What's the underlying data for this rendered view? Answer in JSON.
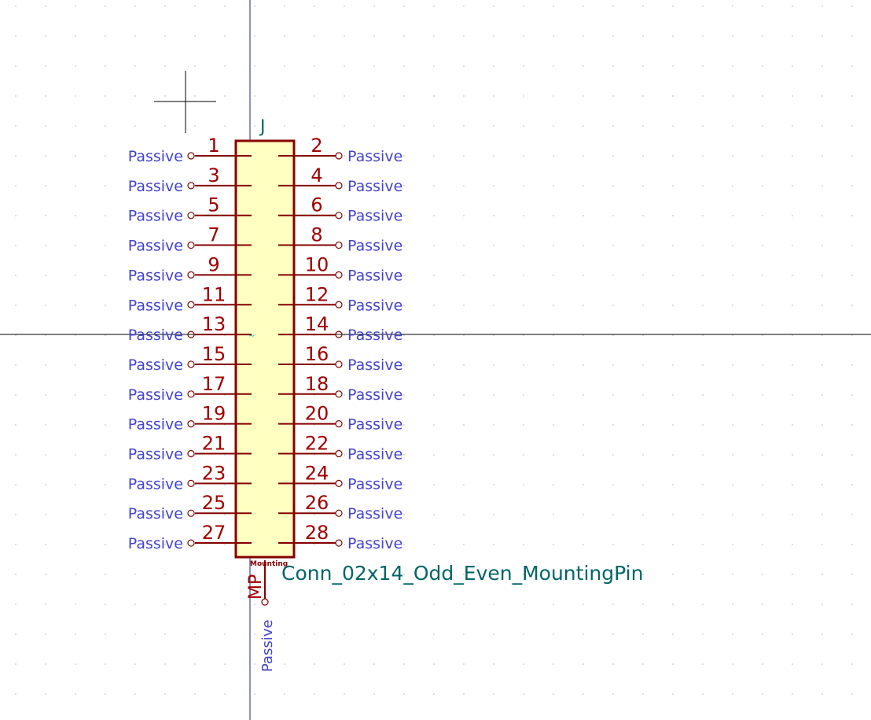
{
  "symbol": {
    "reference": "J",
    "value": "Conn_02x14_Odd_Even_MountingPin",
    "mounting_label": "Mounting",
    "left_pins": [
      "1",
      "3",
      "5",
      "7",
      "9",
      "11",
      "13",
      "15",
      "17",
      "19",
      "21",
      "23",
      "25",
      "27"
    ],
    "right_pins": [
      "2",
      "4",
      "6",
      "8",
      "10",
      "12",
      "14",
      "16",
      "18",
      "20",
      "22",
      "24",
      "26",
      "28"
    ],
    "mounting_pin": {
      "number": "MP",
      "type": "Passive"
    },
    "pin_type": "Passive"
  },
  "colors": {
    "background": "#ffffff",
    "grid_dot": "#c8c8c8",
    "body_outline": "#840000",
    "body_fill": "#ffffc2",
    "pin_line": "#840000",
    "pin_number": "#a00000",
    "pin_type_text": "#4444cc",
    "reference_text": "#006666",
    "value_text": "#006666",
    "axis_blue": "#20208a",
    "axis_black": "#000000"
  }
}
